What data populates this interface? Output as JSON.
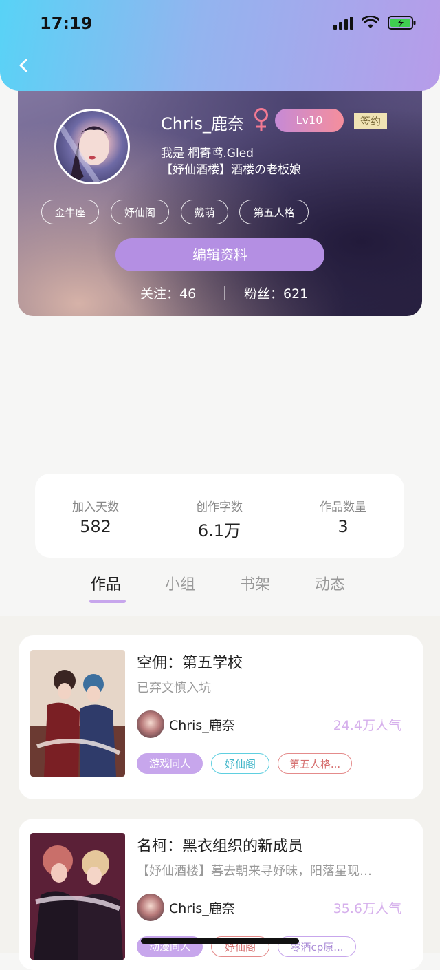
{
  "status_bar": {
    "time": "17:19"
  },
  "profile": {
    "username": "Chris_鹿奈",
    "level": "Lv10",
    "signed_badge": "签约",
    "bio_line1": "我是 桐寄鸢.Gled",
    "bio_line2": "【妤仙酒楼】酒楼の老板娘",
    "tags": [
      "金牛座",
      "妤仙阁",
      "戴萌",
      "第五人格"
    ],
    "edit_button": "编辑资料",
    "following": "关注：46",
    "followers": "粉丝：621"
  },
  "stats": [
    {
      "label": "加入天数",
      "value": "582"
    },
    {
      "label": "创作字数",
      "value": "6.1万"
    },
    {
      "label": "作品数量",
      "value": "3"
    }
  ],
  "tabs": [
    "作品",
    "小组",
    "书架",
    "动态"
  ],
  "active_tab": "作品",
  "works": [
    {
      "title": "空佣：第五学校",
      "subtitle": "已弃文慎入坑",
      "author": "Chris_鹿奈",
      "popularity": "24.4万人气",
      "tags": [
        "游戏同人",
        "妤仙阁",
        "第五人格..."
      ]
    },
    {
      "title": "名柯：黑衣组织的新成员",
      "subtitle": "【妤仙酒楼】暮去朝来寻妤昧，阳落星现…",
      "author": "Chris_鹿奈",
      "popularity": "35.6万人气",
      "tags": [
        "动漫同人",
        "妤仙阁",
        "零酒cp原..."
      ]
    }
  ],
  "colors": {
    "accent_purple": "#b48fe3",
    "popularity_text": "#d6b0ec",
    "tag_purple": "#c7a6ec",
    "tag_cyan": "#5fcfe0",
    "tag_red": "#e48b8b"
  }
}
